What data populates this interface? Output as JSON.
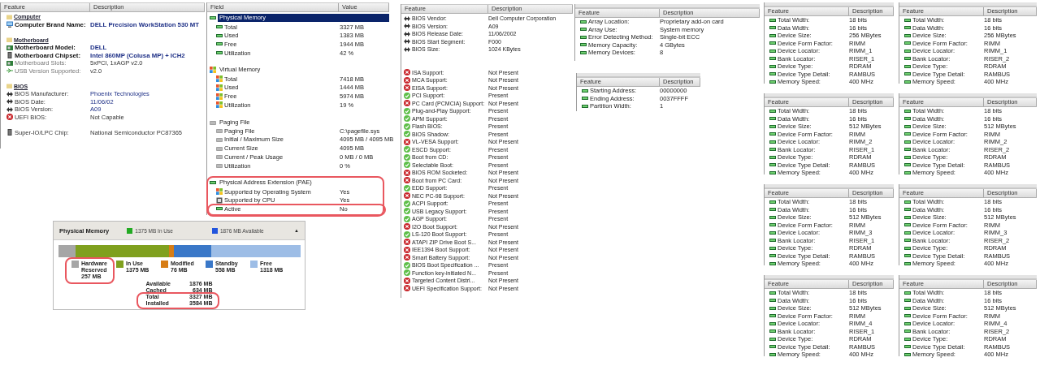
{
  "summary": {
    "columns": [
      "Feature",
      "Description"
    ],
    "groups": [
      {
        "title": "Computer",
        "rows": [
          {
            "kind": "brand",
            "label": "Computer Brand Name:",
            "value": "DELL Precision WorkStation 530 MT"
          }
        ]
      },
      {
        "title": "Motherboard",
        "rows": [
          {
            "kind": "model",
            "label": "Motherboard Model:",
            "value": "DELL"
          },
          {
            "kind": "chipset",
            "label": "Motherboard Chipset:",
            "value": "Intel 860MP (Colusa MP) + ICH2"
          },
          {
            "kind": "slots",
            "label": "Motherboard Slots:",
            "value": "5xPCI, 1xAGP v2.0"
          },
          {
            "kind": "usb",
            "label": "USB Version Supported:",
            "value": "v2.0"
          }
        ]
      },
      {
        "title": "BIOS",
        "rows": [
          {
            "kind": "bios",
            "label": "BIOS Manufacturer:",
            "value": "Phoenix Technologies"
          },
          {
            "kind": "bios",
            "label": "BIOS Date:",
            "value": "11/06/02"
          },
          {
            "kind": "bios",
            "label": "BIOS Version:",
            "value": "A09"
          },
          {
            "kind": "uefi",
            "label": "UEFI BIOS:",
            "value": "Not Capable"
          }
        ]
      },
      {
        "rows": [
          {
            "kind": "superio",
            "label": "Super-IO/LPC Chip:",
            "value": "National Semiconductor PC87365"
          }
        ]
      }
    ]
  },
  "memory": {
    "columns": [
      "Field",
      "Value"
    ],
    "sections": [
      {
        "kind": "ram",
        "title": "Physical Memory",
        "selected": true,
        "circled": false,
        "rows": [
          {
            "kind": "ram",
            "label": "Total",
            "value": "3327 MB",
            "circled": false
          },
          {
            "kind": "ram",
            "label": "Used",
            "value": "1383 MB",
            "circled": false
          },
          {
            "kind": "ram",
            "label": "Free",
            "value": "1944 MB",
            "circled": false
          },
          {
            "kind": "ram",
            "label": "Utilization",
            "value": "42 %",
            "circled": false
          }
        ]
      },
      {
        "kind": "windows",
        "title": "Virtual Memory",
        "selected": false,
        "circled": false,
        "rows": [
          {
            "kind": "windows",
            "label": "Total",
            "value": "7418 MB",
            "circled": false
          },
          {
            "kind": "windows",
            "label": "Used",
            "value": "1444 MB",
            "circled": false
          },
          {
            "kind": "windows",
            "label": "Free",
            "value": "5974 MB",
            "circled": false
          },
          {
            "kind": "windows",
            "label": "Utilization",
            "value": "19 %",
            "circled": false
          }
        ]
      },
      {
        "kind": "drive",
        "title": "Paging File",
        "selected": false,
        "circled": false,
        "rows": [
          {
            "kind": "drive",
            "label": "Paging File",
            "value": "C:\\pagefile.sys",
            "circled": false
          },
          {
            "kind": "drive",
            "label": "Initial / Maximum Size",
            "value": "4095 MB / 4095 MB",
            "circled": false
          },
          {
            "kind": "drive",
            "label": "Current Size",
            "value": "4095 MB",
            "circled": false
          },
          {
            "kind": "drive",
            "label": "Current / Peak Usage",
            "value": "0 MB / 0 MB",
            "circled": false
          },
          {
            "kind": "drive",
            "label": "Utilization",
            "value": "0 %",
            "circled": false
          }
        ]
      },
      {
        "kind": "ram",
        "title": "Physical Address Extension (PAE)",
        "selected": false,
        "circled": true,
        "rows": [
          {
            "kind": "windows",
            "label": "Supported by Operating System",
            "value": "Yes",
            "circled": false
          },
          {
            "kind": "cpu",
            "label": "Supported by CPU",
            "value": "Yes",
            "circled": false
          },
          {
            "kind": "ram",
            "label": "Active",
            "value": "No",
            "circled": true
          }
        ]
      }
    ]
  },
  "resource": {
    "title": "Physical Memory",
    "header_legend": [
      {
        "label": "1375 MB In Use",
        "color": "#22aa22"
      },
      {
        "label": "1876 MB Available",
        "color": "#2255dd"
      }
    ],
    "collapse": "▲",
    "segments": [
      {
        "label": "Hardware Reserved",
        "value": "257 MB",
        "color": "#a6a6a6",
        "circled": true
      },
      {
        "label": "In Use",
        "value": "1375 MB",
        "color": "#7fa01e",
        "circled": false
      },
      {
        "label": "Modified",
        "value": "76 MB",
        "color": "#d77d15",
        "circled": false
      },
      {
        "label": "Standby",
        "value": "558 MB",
        "color": "#3a78c8",
        "circled": false
      },
      {
        "label": "Free",
        "value": "1318 MB",
        "color": "#9dbde6",
        "circled": false
      }
    ],
    "stats": [
      {
        "label": "Available",
        "value": "1876 MB",
        "circled": false
      },
      {
        "label": "Cached",
        "value": "634 MB",
        "circled": false
      },
      {
        "label": "Total",
        "value": "3327 MB",
        "circled": true
      },
      {
        "label": "Installed",
        "value": "3584 MB",
        "circled": true
      }
    ]
  },
  "bios": {
    "columns": [
      "Feature",
      "Description"
    ],
    "groups": [
      [
        {
          "kind": "info",
          "label": "BIOS Vendor:",
          "value": "Dell Computer Corporation"
        },
        {
          "kind": "info",
          "label": "BIOS Version:",
          "value": "A09"
        },
        {
          "kind": "info",
          "label": "BIOS Release Date:",
          "value": "11/06/2002"
        },
        {
          "kind": "info",
          "label": "BIOS Start Segment:",
          "value": "F000"
        },
        {
          "kind": "info",
          "label": "BIOS Size:",
          "value": "1024 KBytes"
        }
      ],
      [
        {
          "kind": "missing",
          "label": "ISA Support:",
          "value": "Not Present"
        },
        {
          "kind": "missing",
          "label": "MCA Support:",
          "value": "Not Present"
        },
        {
          "kind": "missing",
          "label": "EISA Support:",
          "value": "Not Present"
        },
        {
          "kind": "supported",
          "label": "PCI Support:",
          "value": "Present"
        },
        {
          "kind": "missing",
          "label": "PC Card (PCMCIA) Support:",
          "value": "Not Present"
        },
        {
          "kind": "supported",
          "label": "Plug-and-Play Support:",
          "value": "Present"
        },
        {
          "kind": "supported",
          "label": "APM Support:",
          "value": "Present"
        },
        {
          "kind": "supported",
          "label": "Flash BIOS:",
          "value": "Present"
        },
        {
          "kind": "supported",
          "label": "BIOS Shadow:",
          "value": "Present"
        },
        {
          "kind": "missing",
          "label": "VL-VESA Support:",
          "value": "Not Present"
        },
        {
          "kind": "supported",
          "label": "ESCD Support:",
          "value": "Present"
        },
        {
          "kind": "supported",
          "label": "Boot from CD:",
          "value": "Present"
        },
        {
          "kind": "supported",
          "label": "Selectable Boot:",
          "value": "Present"
        },
        {
          "kind": "missing",
          "label": "BIOS ROM Socketed:",
          "value": "Not Present"
        },
        {
          "kind": "missing",
          "label": "Boot from PC Card:",
          "value": "Not Present"
        },
        {
          "kind": "supported",
          "label": "EDD Support:",
          "value": "Present"
        },
        {
          "kind": "missing",
          "label": "NEC PC-98 Support:",
          "value": "Not Present"
        },
        {
          "kind": "supported",
          "label": "ACPI Support:",
          "value": "Present"
        },
        {
          "kind": "supported",
          "label": "USB Legacy Support:",
          "value": "Present"
        },
        {
          "kind": "supported",
          "label": "AGP Support:",
          "value": "Present"
        },
        {
          "kind": "missing",
          "label": "I2O Boot Support:",
          "value": "Not Present"
        },
        {
          "kind": "supported",
          "label": "LS-120 Boot Support:",
          "value": "Present"
        },
        {
          "kind": "missing",
          "label": "ATAPI ZIP Drive Boot S...",
          "value": "Not Present"
        },
        {
          "kind": "missing",
          "label": "IEE1394 Boot Support:",
          "value": "Not Present"
        },
        {
          "kind": "missing",
          "label": "Smart Battery Support:",
          "value": "Not Present"
        },
        {
          "kind": "supported",
          "label": "BIOS Boot Specification ...",
          "value": "Present"
        },
        {
          "kind": "supported",
          "label": "Function key-initiated N...",
          "value": "Present"
        },
        {
          "kind": "missing",
          "label": "Targeted Content Distri...",
          "value": "Not Present"
        },
        {
          "kind": "missing",
          "label": "UEFI Specification Support:",
          "value": "Not Present"
        }
      ]
    ]
  },
  "array": {
    "columns": [
      "Feature",
      "Description"
    ],
    "rows": [
      {
        "label": "Array Location:",
        "value": "Proprietary add-on card"
      },
      {
        "label": "Array Use:",
        "value": "System memory"
      },
      {
        "label": "Error Detecting Method:",
        "value": "Single-bit ECC"
      },
      {
        "label": "Memory Capacity:",
        "value": "4 GBytes"
      },
      {
        "label": "Memory Devices:",
        "value": "8"
      }
    ]
  },
  "partition": {
    "columns": [
      "Feature",
      "Description"
    ],
    "rows": [
      {
        "label": "Starting Address:",
        "value": "00000000"
      },
      {
        "label": "Ending Address:",
        "value": "0037FFFF"
      },
      {
        "label": "Partition Width:",
        "value": "1"
      }
    ]
  },
  "devices": [
    {
      "columns": [
        "Feature",
        "Description"
      ],
      "rows": [
        {
          "label": "Total Width:",
          "value": "18 bits"
        },
        {
          "label": "Data Width:",
          "value": "16 bits"
        },
        {
          "label": "Device Size:",
          "value": "256 MBytes"
        },
        {
          "label": "Device Form Factor:",
          "value": "RIMM"
        },
        {
          "label": "Device Locator:",
          "value": "RIMM_1"
        },
        {
          "label": "Bank Locator:",
          "value": "RISER_1"
        },
        {
          "label": "Device Type:",
          "value": "RDRAM"
        },
        {
          "label": "Device Type Detail:",
          "value": "RAMBUS"
        },
        {
          "label": "Memory Speed:",
          "value": "400 MHz"
        }
      ]
    },
    {
      "columns": [
        "Feature",
        "Description"
      ],
      "rows": [
        {
          "label": "Total Width:",
          "value": "18 bits"
        },
        {
          "label": "Data Width:",
          "value": "16 bits"
        },
        {
          "label": "Device Size:",
          "value": "256 MBytes"
        },
        {
          "label": "Device Form Factor:",
          "value": "RIMM"
        },
        {
          "label": "Device Locator:",
          "value": "RIMM_1"
        },
        {
          "label": "Bank Locator:",
          "value": "RISER_2"
        },
        {
          "label": "Device Type:",
          "value": "RDRAM"
        },
        {
          "label": "Device Type Detail:",
          "value": "RAMBUS"
        },
        {
          "label": "Memory Speed:",
          "value": "400 MHz"
        }
      ]
    },
    {
      "columns": [
        "Feature",
        "Description"
      ],
      "rows": [
        {
          "label": "Total Width:",
          "value": "18 bits"
        },
        {
          "label": "Data Width:",
          "value": "16 bits"
        },
        {
          "label": "Device Size:",
          "value": "512 MBytes"
        },
        {
          "label": "Device Form Factor:",
          "value": "RIMM"
        },
        {
          "label": "Device Locator:",
          "value": "RIMM_2"
        },
        {
          "label": "Bank Locator:",
          "value": "RISER_1"
        },
        {
          "label": "Device Type:",
          "value": "RDRAM"
        },
        {
          "label": "Device Type Detail:",
          "value": "RAMBUS"
        },
        {
          "label": "Memory Speed:",
          "value": "400 MHz"
        }
      ]
    },
    {
      "columns": [
        "Feature",
        "Description"
      ],
      "rows": [
        {
          "label": "Total Width:",
          "value": "18 bits"
        },
        {
          "label": "Data Width:",
          "value": "16 bits"
        },
        {
          "label": "Device Size:",
          "value": "512 MBytes"
        },
        {
          "label": "Device Form Factor:",
          "value": "RIMM"
        },
        {
          "label": "Device Locator:",
          "value": "RIMM_2"
        },
        {
          "label": "Bank Locator:",
          "value": "RISER_2"
        },
        {
          "label": "Device Type:",
          "value": "RDRAM"
        },
        {
          "label": "Device Type Detail:",
          "value": "RAMBUS"
        },
        {
          "label": "Memory Speed:",
          "value": "400 MHz"
        }
      ]
    },
    {
      "columns": [
        "Feature",
        "Description"
      ],
      "rows": [
        {
          "label": "Total Width:",
          "value": "18 bits"
        },
        {
          "label": "Data Width:",
          "value": "16 bits"
        },
        {
          "label": "Device Size:",
          "value": "512 MBytes"
        },
        {
          "label": "Device Form Factor:",
          "value": "RIMM"
        },
        {
          "label": "Device Locator:",
          "value": "RIMM_3"
        },
        {
          "label": "Bank Locator:",
          "value": "RISER_1"
        },
        {
          "label": "Device Type:",
          "value": "RDRAM"
        },
        {
          "label": "Device Type Detail:",
          "value": "RAMBUS"
        },
        {
          "label": "Memory Speed:",
          "value": "400 MHz"
        }
      ]
    },
    {
      "columns": [
        "Feature",
        "Description"
      ],
      "rows": [
        {
          "label": "Total Width:",
          "value": "18 bits"
        },
        {
          "label": "Data Width:",
          "value": "16 bits"
        },
        {
          "label": "Device Size:",
          "value": "512 MBytes"
        },
        {
          "label": "Device Form Factor:",
          "value": "RIMM"
        },
        {
          "label": "Device Locator:",
          "value": "RIMM_3"
        },
        {
          "label": "Bank Locator:",
          "value": "RISER_2"
        },
        {
          "label": "Device Type:",
          "value": "RDRAM"
        },
        {
          "label": "Device Type Detail:",
          "value": "RAMBUS"
        },
        {
          "label": "Memory Speed:",
          "value": "400 MHz"
        }
      ]
    },
    {
      "columns": [
        "Feature",
        "Description"
      ],
      "rows": [
        {
          "label": "Total Width:",
          "value": "18 bits"
        },
        {
          "label": "Data Width:",
          "value": "16 bits"
        },
        {
          "label": "Device Size:",
          "value": "512 MBytes"
        },
        {
          "label": "Device Form Factor:",
          "value": "RIMM"
        },
        {
          "label": "Device Locator:",
          "value": "RIMM_4"
        },
        {
          "label": "Bank Locator:",
          "value": "RISER_1"
        },
        {
          "label": "Device Type:",
          "value": "RDRAM"
        },
        {
          "label": "Device Type Detail:",
          "value": "RAMBUS"
        },
        {
          "label": "Memory Speed:",
          "value": "400 MHz"
        }
      ]
    },
    {
      "columns": [
        "Feature",
        "Description"
      ],
      "rows": [
        {
          "label": "Total Width:",
          "value": "18 bits"
        },
        {
          "label": "Data Width:",
          "value": "16 bits"
        },
        {
          "label": "Device Size:",
          "value": "512 MBytes"
        },
        {
          "label": "Device Form Factor:",
          "value": "RIMM"
        },
        {
          "label": "Device Locator:",
          "value": "RIMM_4"
        },
        {
          "label": "Bank Locator:",
          "value": "RISER_2"
        },
        {
          "label": "Device Type:",
          "value": "RDRAM"
        },
        {
          "label": "Device Type Detail:",
          "value": "RAMBUS"
        },
        {
          "label": "Memory Speed:",
          "value": "400 MHz"
        }
      ]
    }
  ]
}
